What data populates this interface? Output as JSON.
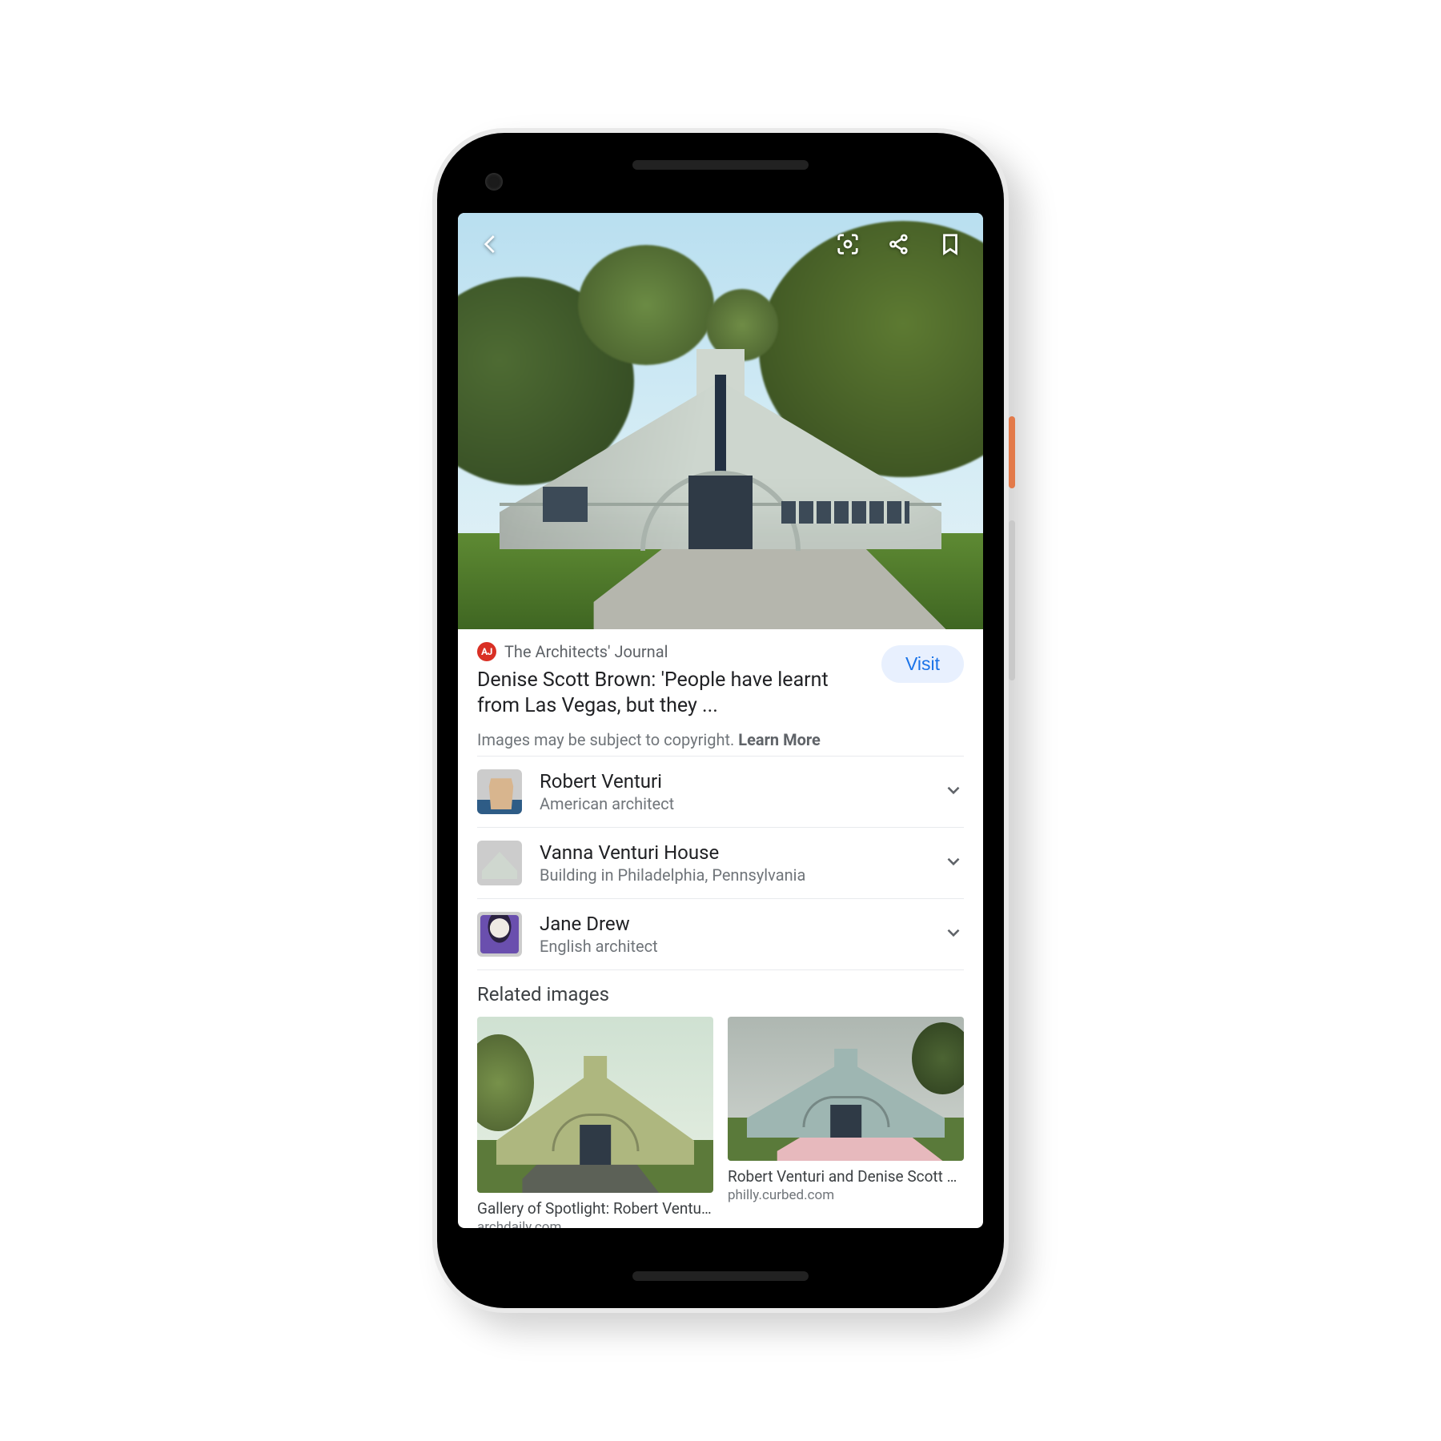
{
  "overlay": {
    "back_icon": "back-icon",
    "lens_icon": "lens-icon",
    "share_icon": "share-icon",
    "bookmark_icon": "bookmark-icon"
  },
  "source": {
    "badge_label": "AJ",
    "name": "The Architects' Journal",
    "headline": "Denise Scott Brown: 'People have learnt from Las Vegas, but they ...",
    "visit_label": "Visit"
  },
  "copyright": {
    "text": "Images may be subject to copyright. ",
    "learn_more": "Learn More"
  },
  "entities": [
    {
      "name": "Robert Venturi",
      "sub": "American architect"
    },
    {
      "name": "Vanna Venturi House",
      "sub": "Building in Philadelphia, Pennsylvania"
    },
    {
      "name": "Jane Drew",
      "sub": "English architect"
    }
  ],
  "related": {
    "title": "Related images",
    "cards": [
      {
        "title": "Gallery of Spotlight: Robert Venturi …",
        "src": "archdaily.com"
      },
      {
        "title": "Robert Venturi and Denise Scott Br…",
        "src": "philly.curbed.com"
      }
    ]
  }
}
